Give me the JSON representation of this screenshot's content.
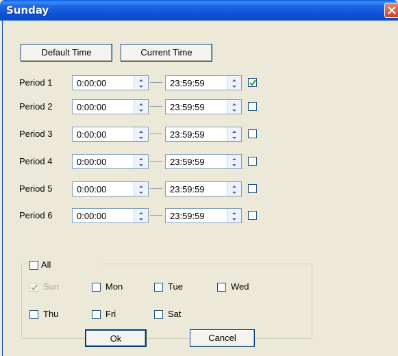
{
  "window": {
    "title": "Sunday"
  },
  "buttons": {
    "default_time": "Default Time",
    "current_time": "Current Time",
    "ok": "Ok",
    "cancel": "Cancel"
  },
  "periods": [
    {
      "label": "Period 1",
      "start": "0:00:00",
      "end": "23:59:59",
      "enabled": true
    },
    {
      "label": "Period 2",
      "start": "0:00:00",
      "end": "23:59:59",
      "enabled": false
    },
    {
      "label": "Period 3",
      "start": "0:00:00",
      "end": "23:59:59",
      "enabled": false
    },
    {
      "label": "Period 4",
      "start": "0:00:00",
      "end": "23:59:59",
      "enabled": false
    },
    {
      "label": "Period 5",
      "start": "0:00:00",
      "end": "23:59:59",
      "enabled": false
    },
    {
      "label": "Period 6",
      "start": "0:00:00",
      "end": "23:59:59",
      "enabled": false
    }
  ],
  "copy_group": {
    "all_label": "All",
    "all_checked": false,
    "days": [
      {
        "label": "Sun",
        "checked": true,
        "disabled": true
      },
      {
        "label": "Mon",
        "checked": false,
        "disabled": false
      },
      {
        "label": "Tue",
        "checked": false,
        "disabled": false
      },
      {
        "label": "Wed",
        "checked": false,
        "disabled": false
      },
      {
        "label": "Thu",
        "checked": false,
        "disabled": false
      },
      {
        "label": "Fri",
        "checked": false,
        "disabled": false
      },
      {
        "label": "Sat",
        "checked": false,
        "disabled": false
      }
    ]
  },
  "colors": {
    "titlebar": "#0A48C4",
    "dialog_bg": "#ECE9D8",
    "field_border": "#7F9DB9"
  }
}
